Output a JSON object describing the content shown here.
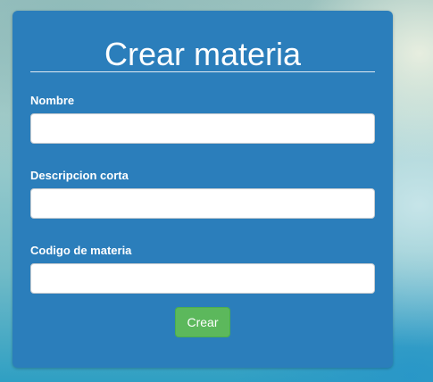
{
  "form": {
    "title": "Crear materia",
    "fields": [
      {
        "label": "Nombre",
        "value": "",
        "placeholder": ""
      },
      {
        "label": "Descripcion corta",
        "value": "",
        "placeholder": ""
      },
      {
        "label": "Codigo de materia",
        "value": "",
        "placeholder": ""
      }
    ],
    "submit_label": "Crear"
  },
  "colors": {
    "card": "#2b7ebb",
    "submit": "#5cb85c",
    "text": "#ffffff"
  }
}
